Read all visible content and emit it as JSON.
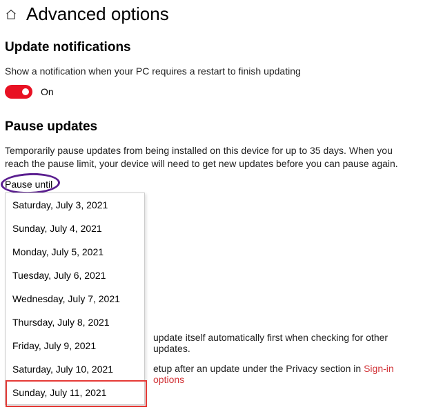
{
  "header": {
    "title": "Advanced options"
  },
  "notifications": {
    "heading": "Update notifications",
    "body": "Show a notification when your PC requires a restart to finish updating",
    "toggle_state_label": "On"
  },
  "pause": {
    "heading": "Pause updates",
    "body": "Temporarily pause updates from being installed on this device for up to 35 days. When you reach the pause limit, your device will need to get new updates before you can pause again.",
    "label": "Pause until",
    "options": [
      "Saturday, July 3, 2021",
      "Sunday, July 4, 2021",
      "Monday, July 5, 2021",
      "Tuesday, July 6, 2021",
      "Wednesday, July 7, 2021",
      "Thursday, July 8, 2021",
      "Friday, July 9, 2021",
      "Saturday, July 10, 2021",
      "Sunday, July 11, 2021"
    ]
  },
  "background": {
    "line1_tail": "update itself automatically first when checking for other updates.",
    "line2_tail_pre": "etup after an update under the Privacy section in ",
    "line2_link": "Sign-in options"
  }
}
